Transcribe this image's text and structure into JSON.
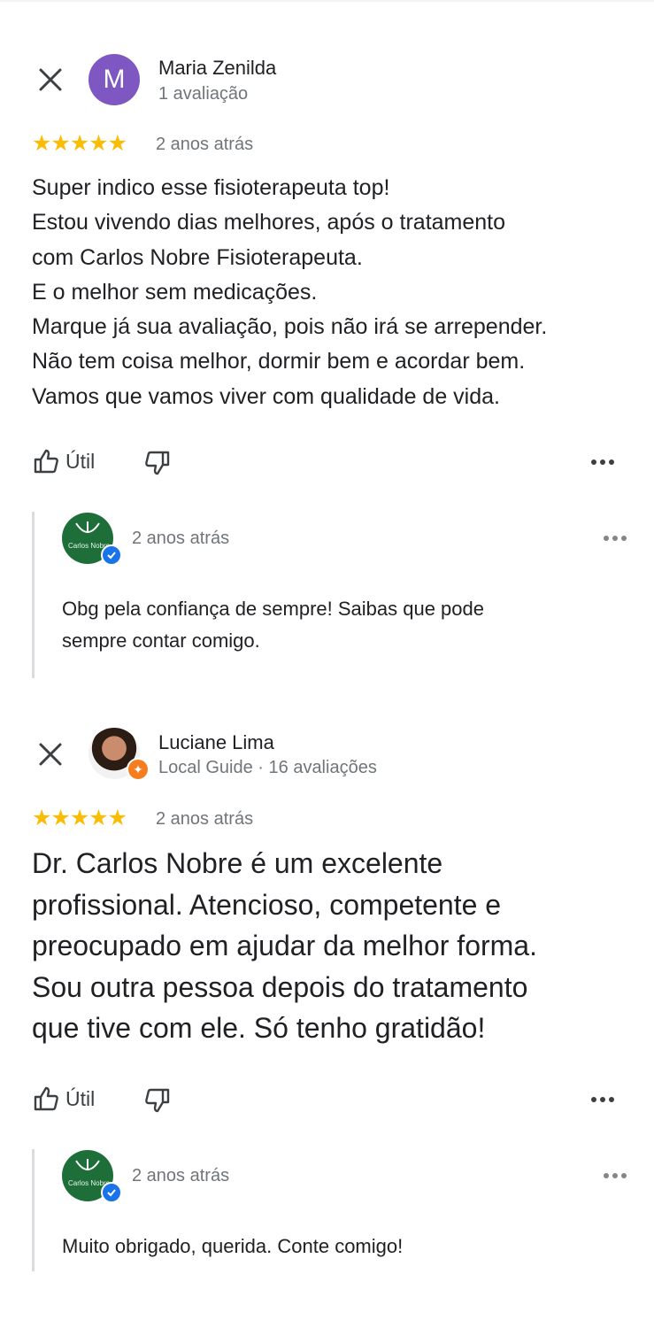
{
  "reviews": [
    {
      "avatar_letter": "M",
      "name": "Maria Zenilda",
      "subtitle": "1 avaliação",
      "rating_stars": 5,
      "stars": "★★★★★",
      "date": "2 anos atrás",
      "text_lines": [
        "Super indico esse fisioterapeuta top!",
        "Estou vivendo dias melhores, após o tratamento",
        "com Carlos Nobre Fisioterapeuta.",
        "E o melhor sem medicações.",
        "Marque já sua avaliação, pois não irá se arrepender.",
        "Não tem coisa melhor, dormir bem e acordar bem.",
        "Vamos que vamos viver com qualidade de vida."
      ],
      "helpful_label": "Útil",
      "reply": {
        "logo_text": "Carlos Nobre",
        "date": "2 anos atrás",
        "text_lines": [
          "Obg pela confiança de sempre! Saibas que pode",
          "sempre contar comigo."
        ]
      }
    },
    {
      "name": "Luciane Lima",
      "subtitle": "Local Guide · 16 avaliações",
      "rating_stars": 5,
      "stars": "★★★★★",
      "date": "2 anos atrás",
      "text_lines": [
        "Dr. Carlos Nobre é um excelente",
        "profissional. Atencioso, competente e",
        "preocupado em ajudar da melhor forma.",
        "Sou outra pessoa  depois do tratamento",
        "que tive com ele. Só tenho gratidão!"
      ],
      "helpful_label": "Útil",
      "reply": {
        "logo_text": "Carlos Nobre",
        "date": "2 anos atrás",
        "text_lines": [
          "Muito obrigado, querida. Conte comigo!"
        ]
      }
    }
  ],
  "icons": {
    "close": "close-icon",
    "thumb_up": "thumb-up-icon",
    "thumb_down": "thumb-down-icon",
    "more": "more-horizontal-icon",
    "verified": "verified-check-icon",
    "local_guide": "local-guide-star-icon"
  },
  "colors": {
    "star": "#fbbc04",
    "avatar_purple": "#7e57c2",
    "secondary_text": "#70757a",
    "owner_logo_green": "#1e6e3a",
    "verified_blue": "#1a73e8",
    "local_guide_orange": "#f57c1f"
  }
}
